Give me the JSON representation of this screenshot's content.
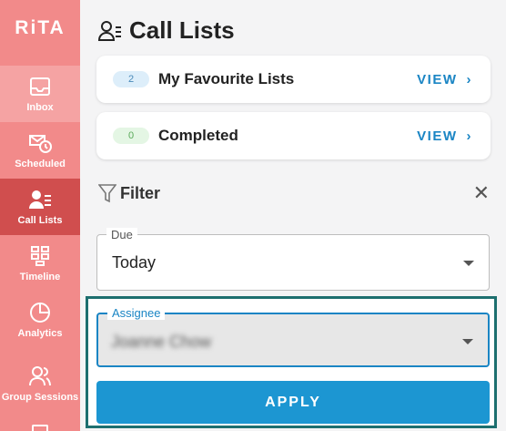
{
  "app": {
    "logo": "RiTA"
  },
  "sidebar": {
    "items": [
      {
        "label": "Inbox",
        "icon": "inbox-icon"
      },
      {
        "label": "Scheduled",
        "icon": "scheduled-icon"
      },
      {
        "label": "Call Lists",
        "icon": "call-lists-icon",
        "active": true
      },
      {
        "label": "Timeline",
        "icon": "timeline-icon"
      },
      {
        "label": "Analytics",
        "icon": "analytics-icon"
      },
      {
        "label": "Group Sessions",
        "icon": "group-sessions-icon"
      }
    ]
  },
  "page": {
    "title": "Call Lists"
  },
  "cards": [
    {
      "badge": "2",
      "title": "My Favourite Lists",
      "action": "VIEW"
    },
    {
      "badge": "0",
      "title": "Completed",
      "action": "VIEW"
    }
  ],
  "filter": {
    "title": "Filter",
    "due": {
      "label": "Due",
      "value": "Today"
    },
    "assignee": {
      "label": "Assignee",
      "value": "Joanne Chow"
    },
    "apply_label": "APPLY"
  },
  "colors": {
    "sidebar": "#f28a8a",
    "sidebar_active": "#d04e4e",
    "accent": "#1a85c4",
    "apply": "#1c96d2",
    "highlight": "#1d6f6f"
  }
}
